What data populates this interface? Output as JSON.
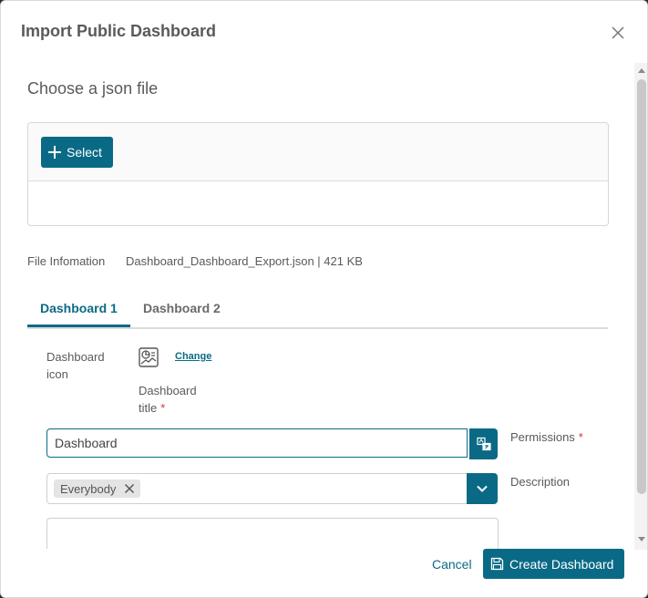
{
  "dialog": {
    "title": "Import Public Dashboard"
  },
  "upload": {
    "heading": "Choose a json file",
    "select_label": "Select"
  },
  "file_info": {
    "label": "File Infomation",
    "value": "Dashboard_Dashboard_Export.json | 421 KB"
  },
  "tabs": [
    {
      "label": "Dashboard 1",
      "active": true
    },
    {
      "label": "Dashboard 2",
      "active": false
    }
  ],
  "form": {
    "icon_label": "Dashboard icon",
    "change_label": "Change",
    "title_label": "Dashboard title",
    "title_value": "Dashboard",
    "required_mark": "*",
    "permissions_label": "Permissions",
    "permissions_chip": "Everybody",
    "description_label": "Description"
  },
  "footer": {
    "cancel_label": "Cancel",
    "create_label": "Create Dashboard"
  },
  "colors": {
    "accent": "#0a6a86",
    "required": "#d0363b"
  }
}
